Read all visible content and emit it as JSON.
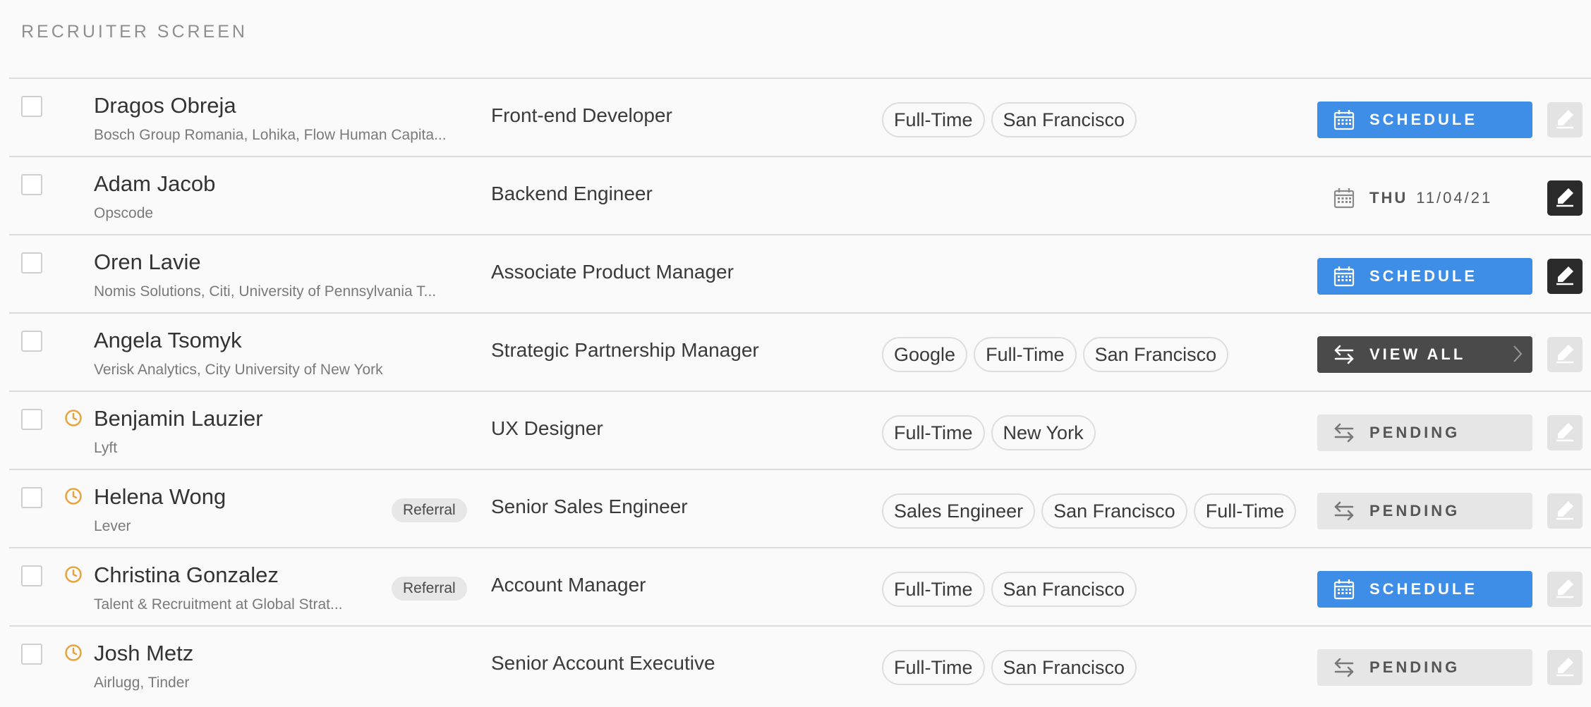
{
  "section": {
    "title": "RECRUITER SCREEN"
  },
  "colors": {
    "accent": "#3e8ee8",
    "dark_button": "#4a4a4a",
    "pending_bg": "#e6e6e6",
    "clock": "#e8a33d"
  },
  "candidates": [
    {
      "name": "Dragos Obreja",
      "company": "Bosch Group Romania, Lohika, Flow Human Capita...",
      "job": "Front-end Developer",
      "tags": [
        "Full-Time",
        "San Francisco"
      ],
      "action": {
        "type": "schedule",
        "label": "SCHEDULE"
      },
      "edit": "light",
      "clock": false,
      "referral": ""
    },
    {
      "name": "Adam Jacob",
      "company": "Opscode",
      "job": "Backend Engineer",
      "tags": [],
      "action": {
        "type": "date",
        "dow": "THU",
        "date": "11/04/21"
      },
      "edit": "dark",
      "clock": false,
      "referral": ""
    },
    {
      "name": "Oren Lavie",
      "company": "Nomis Solutions, Citi, University of Pennsylvania T...",
      "job": "Associate Product Manager",
      "tags": [],
      "action": {
        "type": "schedule",
        "label": "SCHEDULE"
      },
      "edit": "dark",
      "clock": false,
      "referral": ""
    },
    {
      "name": "Angela Tsomyk",
      "company": "Verisk Analytics, City University of New York",
      "job": "Strategic Partnership Manager",
      "tags": [
        "Google",
        "Full-Time",
        "San Francisco"
      ],
      "action": {
        "type": "view-all",
        "label": "VIEW ALL"
      },
      "edit": "light",
      "clock": false,
      "referral": ""
    },
    {
      "name": "Benjamin Lauzier",
      "company": "Lyft",
      "job": "UX Designer",
      "tags": [
        "Full-Time",
        "New York"
      ],
      "action": {
        "type": "pending",
        "label": "PENDING"
      },
      "edit": "light",
      "clock": true,
      "referral": ""
    },
    {
      "name": "Helena Wong",
      "company": "Lever",
      "job": "Senior Sales Engineer",
      "tags": [
        "Sales Engineer",
        "San Francisco",
        "Full-Time"
      ],
      "action": {
        "type": "pending",
        "label": "PENDING"
      },
      "edit": "light",
      "clock": true,
      "referral": "Referral"
    },
    {
      "name": "Christina Gonzalez",
      "company": "Talent & Recruitment at Global Strat...",
      "job": "Account Manager",
      "tags": [
        "Full-Time",
        "San Francisco"
      ],
      "action": {
        "type": "schedule",
        "label": "SCHEDULE"
      },
      "edit": "light",
      "clock": true,
      "referral": "Referral"
    },
    {
      "name": "Josh Metz",
      "company": "Airlugg, Tinder",
      "job": "Senior Account Executive",
      "tags": [
        "Full-Time",
        "San Francisco"
      ],
      "action": {
        "type": "pending",
        "label": "PENDING"
      },
      "edit": "light",
      "clock": true,
      "referral": ""
    }
  ]
}
